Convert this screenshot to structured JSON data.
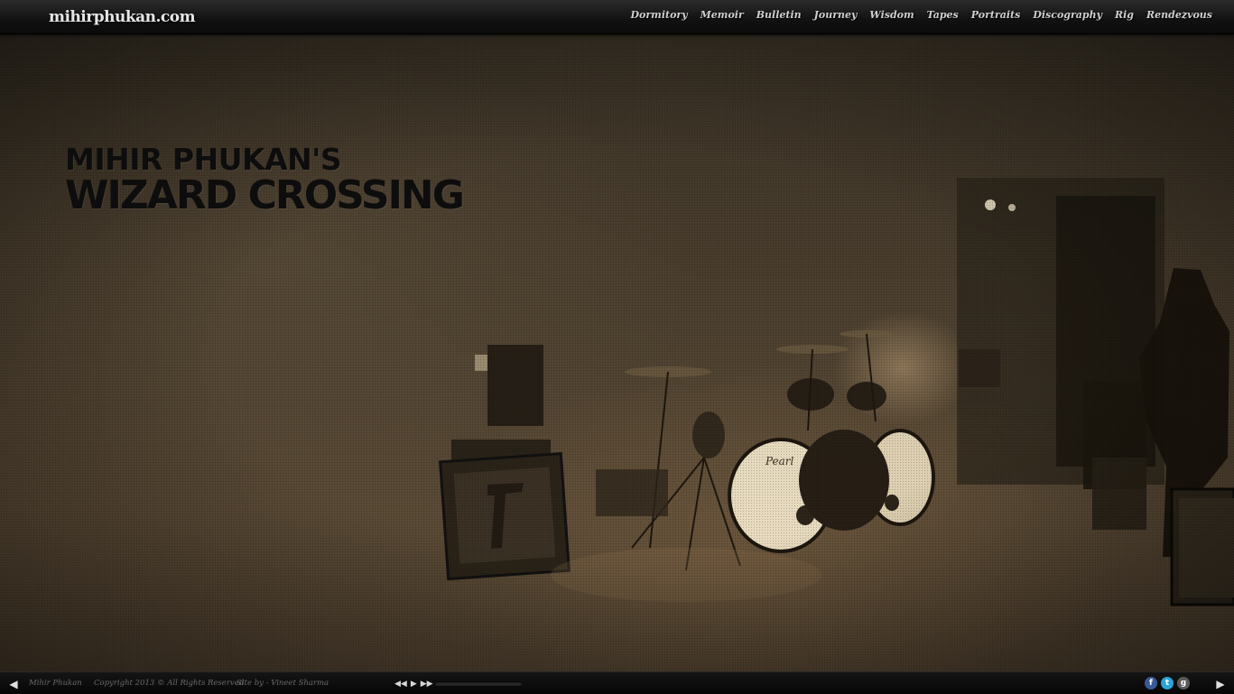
{
  "header": {
    "logo": "mihirphukan.com",
    "nav": [
      "Dormitory",
      "Memoir",
      "Bulletin",
      "Journey",
      "Wisdom",
      "Tapes",
      "Portraits",
      "Discography",
      "Rig",
      "Rendezvous"
    ]
  },
  "hero": {
    "line1": "Mihir Phukan's",
    "line2": "Wizard Crossing"
  },
  "footer": {
    "name": "Mihir Phukan",
    "copyright": "Copyright 2013 © All Rights Reserved",
    "credit": "Site by - Vineet Sharma",
    "player": {
      "rewind_icon": "rewind-icon",
      "play_icon": "play-icon",
      "forward_icon": "fast-forward-icon",
      "progress": 0
    },
    "social": [
      {
        "icon": "facebook-icon",
        "glyph": "f",
        "color": "#3b5998"
      },
      {
        "icon": "twitter-icon",
        "glyph": "t",
        "color": "#2aa4d8"
      },
      {
        "icon": "google-plus-icon",
        "glyph": "g",
        "color": "#5a5a5a"
      }
    ]
  },
  "arrows": {
    "prev_icon": "chevron-left-icon",
    "next_icon": "chevron-right-icon"
  },
  "colors": {
    "topbar": "#111111",
    "scene_sepia": "#4a3e2e",
    "headline": "#0d0d0d"
  }
}
